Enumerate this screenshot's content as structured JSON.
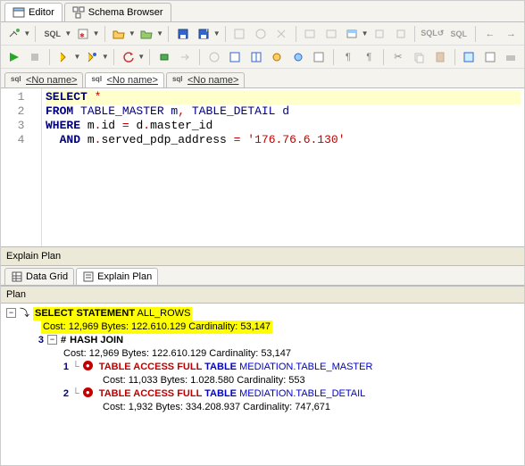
{
  "topTabs": {
    "editor": "Editor",
    "schema": "Schema Browser"
  },
  "editorTabs": {
    "t1": "<No name>",
    "t2": "<No name>",
    "t3": "<No name>"
  },
  "sql": {
    "line1_a": "SELECT",
    "line1_b": " *",
    "line2_a": "FROM",
    "line2_b": " TABLE_MASTER m",
    "line2_c": ",",
    "line2_d": " TABLE_DETAIL d",
    "line3_a": "WHERE",
    "line3_b": " m",
    "line3_c": ".",
    "line3_d": "id ",
    "line3_e": "=",
    "line3_f": " d",
    "line3_g": ".",
    "line3_h": "master_id",
    "line4_a": "  AND",
    "line4_b": " m",
    "line4_c": ".",
    "line4_d": "served_pdp_address ",
    "line4_e": "=",
    "line4_f": " ",
    "line4_g": "'176.76.6.130'"
  },
  "gutter": {
    "l1": "1",
    "l2": "2",
    "l3": "3",
    "l4": "4"
  },
  "section": {
    "explain": "Explain Plan"
  },
  "bottomTabs": {
    "grid": "Data Grid",
    "plan": "Explain Plan"
  },
  "planCol": "Plan",
  "plan": {
    "stmt": "SELECT STATEMENT",
    "stmtMode": "  ALL_ROWS",
    "stmtCost": "Cost: 12,969  Bytes: 122.610.129  Cardinality: 53,147",
    "hashStep": "3",
    "hashName": "HASH JOIN",
    "hashCost": "Cost: 12,969  Bytes: 122.610.129  Cardinality: 53,147",
    "t1Step": "1",
    "t1Op": "TABLE ACCESS FULL",
    "t1Kw": " TABLE ",
    "t1Name": "MEDIATION.TABLE_MASTER",
    "t1Cost": "Cost: 11,033  Bytes: 1.028.580  Cardinality: 553",
    "t2Step": "2",
    "t2Op": "TABLE ACCESS FULL",
    "t2Kw": " TABLE ",
    "t2Name": "MEDIATION.TABLE_DETAIL",
    "t2Cost": "Cost: 1,932  Bytes: 334.208.937  Cardinality: 747,671"
  }
}
